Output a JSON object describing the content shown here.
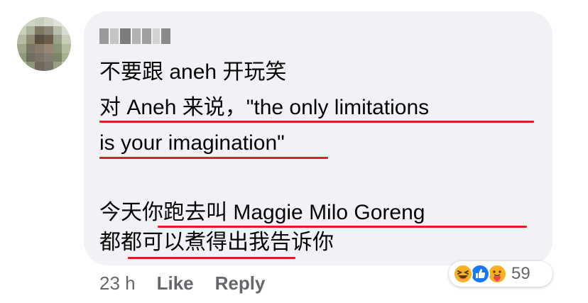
{
  "comment": {
    "lines": [
      "不要跟 aneh 开玩笑",
      "对 Aneh 来说，\"the only limitations",
      "is your imagination\"",
      "今天你跑去叫 Maggie Milo Goreng",
      "都都可以煮得出我告诉你"
    ]
  },
  "footer": {
    "time": "23 h",
    "like_label": "Like",
    "reply_label": "Reply"
  },
  "reactions": {
    "icons": [
      "haha-icon",
      "like-icon",
      "care-icon"
    ],
    "count": "59"
  },
  "colors": {
    "bubble": "#f0f2f5",
    "underline": "#e02020",
    "meta_text": "#65676b",
    "like_blue": "#1877f2",
    "haha_yellow": "#f7b125"
  }
}
